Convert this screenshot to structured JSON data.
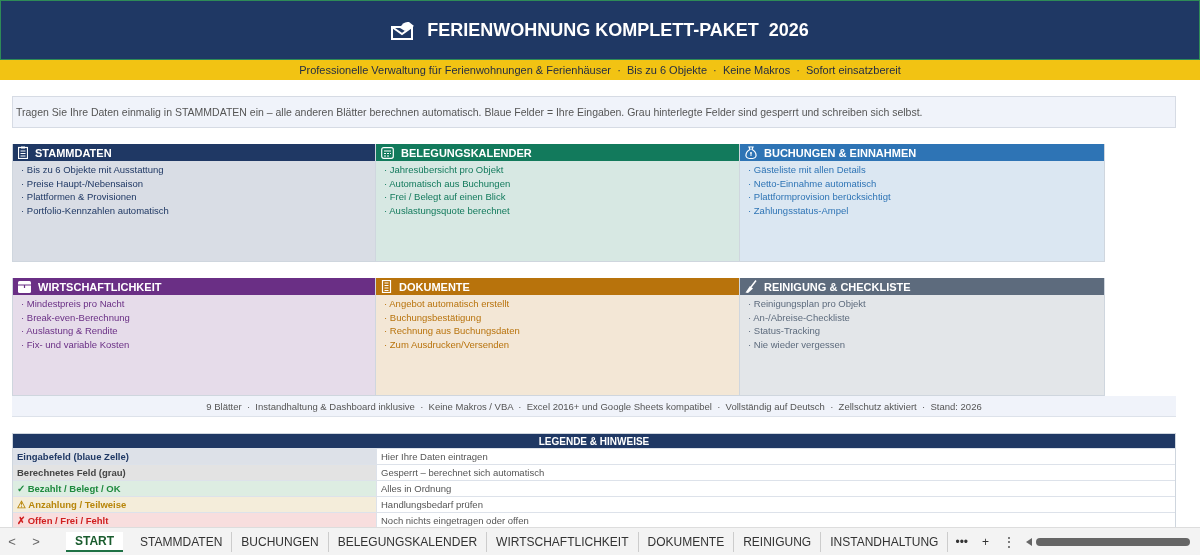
{
  "header": {
    "title": "FERIENWOHNUNG KOMPLETT-PAKET  2026",
    "subtitle": "Professionelle Verwaltung für Ferienwohnungen & Ferienhäuser  ·  Bis zu 6 Objekte  ·  Keine Makros  ·  Sofort einsatzbereit"
  },
  "intro": "Tragen Sie Ihre Daten einmalig in STAMMDATEN ein – alle anderen Blätter berechnen automatisch. Blaue Felder = Ihre Eingaben. Grau hinterlegte Felder sind gesperrt und schreiben sich selbst.",
  "sections": [
    {
      "title": "STAMMDATEN",
      "color": "#1f3864",
      "items": [
        "· Bis zu 6 Objekte mit Ausstattung",
        "· Preise Haupt-/Nebensaison",
        "· Plattformen & Provisionen",
        "· Portfolio-Kennzahlen automatisch"
      ]
    },
    {
      "title": "BELEGUNGSKALENDER",
      "color": "#127a5c",
      "items": [
        "· Jahresübersicht pro Objekt",
        "· Automatisch aus Buchungen",
        "· Frei / Belegt auf einen Blick",
        "· Auslastungsquote berechnet"
      ]
    },
    {
      "title": "BUCHUNGEN & EINNAHMEN",
      "color": "#2e74b5",
      "items": [
        "· Gästeliste mit allen Details",
        "· Netto-Einnahme automatisch",
        "· Plattformprovision berücksichtigt",
        "· Zahlungsstatus-Ampel"
      ]
    },
    {
      "title": "WIRTSCHAFTLICHKEIT",
      "color": "#6a2f85",
      "items": [
        "· Mindestpreis pro Nacht",
        "· Break-even-Berechnung",
        "· Auslastung & Rendite",
        "· Fix- und variable Kosten"
      ]
    },
    {
      "title": "DOKUMENTE",
      "color": "#b8730c",
      "items": [
        "· Angebot automatisch erstellt",
        "· Buchungsbestätigung",
        "· Rechnung aus Buchungsdaten",
        "· Zum Ausdrucken/Versenden"
      ]
    },
    {
      "title": "REINIGUNG & CHECKLISTE",
      "color": "#5d6b7d",
      "items": [
        "· Reinigungsplan pro Objekt",
        "· An-/Abreise-Checkliste",
        "· Status-Tracking",
        "· Nie wieder vergessen"
      ]
    }
  ],
  "footer_note": "9 Blätter  ·  Instandhaltung & Dashboard inklusive  ·  Keine Makros / VBA  ·  Excel 2016+ und Google Sheets kompatibel  ·  Vollständig auf Deutsch  ·  Zellschutz aktiviert  ·  Stand: 2026",
  "legend": {
    "title": "LEGENDE & HINWEISE",
    "rows": [
      {
        "label": "Eingabefeld (blaue Zelle)",
        "note": "Hier Ihre Daten eintragen",
        "color": "#1f3864"
      },
      {
        "label": "Berechnetes Feld (grau)",
        "note": "Gesperrt – berechnet sich automatisch",
        "color": "#444444"
      },
      {
        "label": "✓ Bezahlt / Belegt / OK",
        "note": "Alles in Ordnung",
        "color": "#1e8a3e"
      },
      {
        "label": "⚠ Anzahlung / Teilweise",
        "note": "Handlungsbedarf prüfen",
        "color": "#b8860b"
      },
      {
        "label": "✗ Offen / Frei / Fehlt",
        "note": "Noch nichts eingetragen oder offen",
        "color": "#d02020"
      }
    ]
  },
  "sheet_tabs": {
    "prev": "<",
    "next": ">",
    "more": "•••",
    "add": "+",
    "menu": "⋮",
    "tabs": [
      {
        "label": "START",
        "selected": true
      },
      {
        "label": "STAMMDATEN",
        "selected": false
      },
      {
        "label": "BUCHUNGEN",
        "selected": false
      },
      {
        "label": "BELEGUNGSKALENDER",
        "selected": false
      },
      {
        "label": "WIRTSCHAFTLICHKEIT",
        "selected": false
      },
      {
        "label": "DOKUMENTE",
        "selected": false
      },
      {
        "label": "REINIGUNG",
        "selected": false
      },
      {
        "label": "INSTANDHALTUNG",
        "selected": false
      }
    ]
  }
}
